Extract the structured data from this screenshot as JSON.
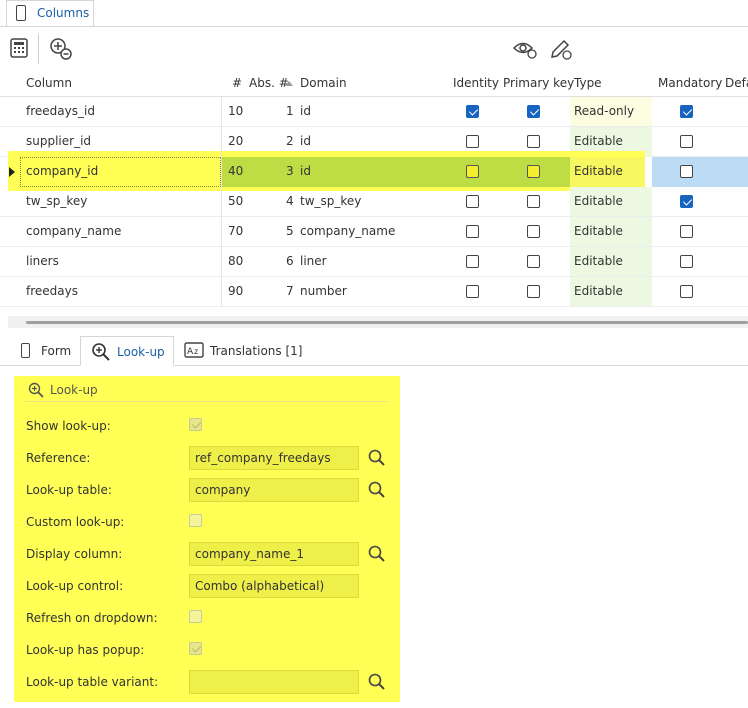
{
  "top_tab": {
    "label": "Columns"
  },
  "grid": {
    "headers": {
      "column": "Column",
      "num": "#",
      "abs_num": "Abs. #",
      "domain": "Domain",
      "identity": "Identity",
      "primary_key": "Primary key",
      "type": "Type",
      "mandatory": "Mandatory",
      "default": "Defa"
    },
    "rows": [
      {
        "column": "freedays_id",
        "num": "10",
        "abs": "1",
        "domain": "id",
        "identity": true,
        "primary_key": true,
        "type": "Read-only",
        "mandatory": true
      },
      {
        "column": "supplier_id",
        "num": "20",
        "abs": "2",
        "domain": "id",
        "identity": false,
        "primary_key": false,
        "type": "Editable",
        "mandatory": false
      },
      {
        "column": "company_id",
        "num": "40",
        "abs": "3",
        "domain": "id",
        "identity": false,
        "primary_key": false,
        "type": "Editable",
        "mandatory": false,
        "selected": true
      },
      {
        "column": "tw_sp_key",
        "num": "50",
        "abs": "4",
        "domain": "tw_sp_key",
        "identity": false,
        "primary_key": false,
        "type": "Editable",
        "mandatory": true
      },
      {
        "column": "company_name",
        "num": "70",
        "abs": "5",
        "domain": "company_name",
        "identity": false,
        "primary_key": false,
        "type": "Editable",
        "mandatory": false
      },
      {
        "column": "liners",
        "num": "80",
        "abs": "6",
        "domain": "liner",
        "identity": false,
        "primary_key": false,
        "type": "Editable",
        "mandatory": false
      },
      {
        "column": "freedays",
        "num": "90",
        "abs": "7",
        "domain": "number",
        "identity": false,
        "primary_key": false,
        "type": "Editable",
        "mandatory": false
      }
    ]
  },
  "bottom_tabs": {
    "form": "Form",
    "lookup": "Look-up",
    "translations": "Translations [1]"
  },
  "lookup_panel": {
    "title": "Look-up",
    "show_lookup_label": "Show look-up:",
    "show_lookup": true,
    "reference_label": "Reference:",
    "reference": "ref_company_freedays",
    "lookup_table_label": "Look-up table:",
    "lookup_table": "company",
    "custom_lookup_label": "Custom look-up:",
    "custom_lookup": false,
    "display_column_label": "Display column:",
    "display_column": "company_name_1",
    "lookup_control_label": "Look-up control:",
    "lookup_control": "Combo (alphabetical)",
    "refresh_label": "Refresh on dropdown:",
    "refresh": false,
    "has_popup_label": "Look-up has popup:",
    "has_popup": true,
    "variant_label": "Look-up table variant:",
    "variant": ""
  },
  "colors": {
    "accent": "#1664c0",
    "highlight": "#ffff55",
    "selected_row": "#bedd44",
    "readonly_bg": "#fdfde2",
    "editable_bg": "#ecf8e2",
    "mandatory_selected": "#bcdcf6"
  }
}
